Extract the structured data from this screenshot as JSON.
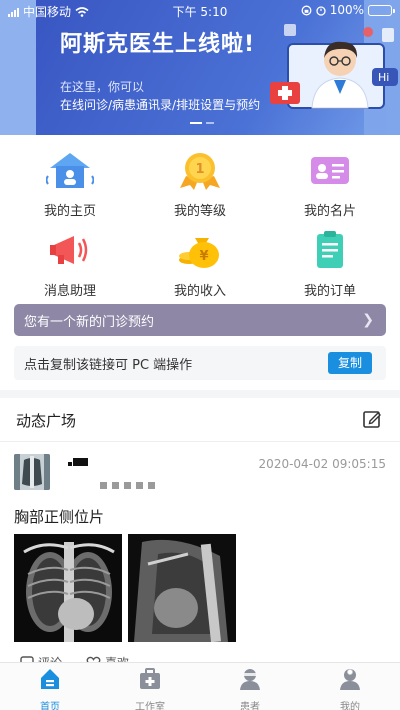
{
  "status_bar": {
    "carrier": "中国移动",
    "time": "下午 5:10",
    "battery": "100%"
  },
  "banner": {
    "title": "阿斯克医生上线啦!",
    "subtitle": "在这里，你可以",
    "features": "在线问诊/病患通讯录/排班设置与预约",
    "badge_text": "Hi"
  },
  "grid": [
    {
      "label": "我的主页",
      "icon": "house-icon"
    },
    {
      "label": "我的等级",
      "icon": "medal-icon"
    },
    {
      "label": "我的名片",
      "icon": "id-card-icon"
    },
    {
      "label": "消息助理",
      "icon": "megaphone-icon"
    },
    {
      "label": "我的收入",
      "icon": "money-bag-icon"
    },
    {
      "label": "我的订单",
      "icon": "clipboard-icon"
    }
  ],
  "notice": {
    "text": "您有一个新的门诊预约"
  },
  "copy_row": {
    "text": "点击复制该链接可 PC 端操作",
    "button": "复制"
  },
  "feed": {
    "title": "动态广场",
    "post": {
      "timestamp": "2020-04-02 09:05:15",
      "text": "胸部正侧位片",
      "actions": {
        "comment": "评论",
        "like": "喜欢"
      }
    }
  },
  "tabbar": [
    {
      "label": "首页",
      "active": true
    },
    {
      "label": "工作室",
      "active": false
    },
    {
      "label": "患者",
      "active": false
    },
    {
      "label": "我的",
      "active": false
    }
  ],
  "colors": {
    "primary": "#1a8fe0",
    "banner": "#4a74d8",
    "notice": "#8e87a6"
  }
}
